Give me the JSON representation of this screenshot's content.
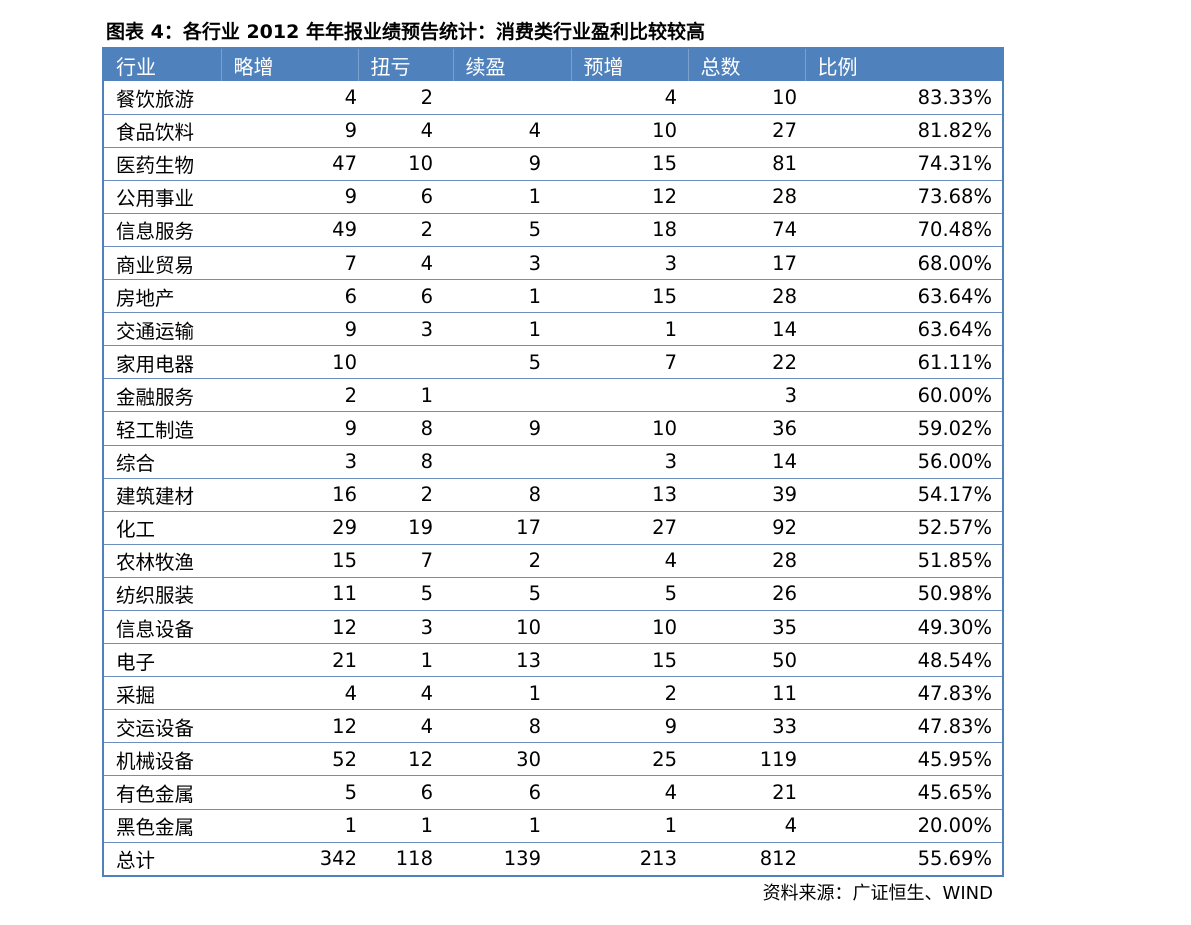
{
  "title": "图表 4：各行业 2012 年年报业绩预告统计：消费类行业盈利比较较高",
  "columns": [
    "行业",
    "略增",
    "扭亏",
    "续盈",
    "预增",
    "总数",
    "比例"
  ],
  "rows": [
    {
      "name": "餐饮旅游",
      "lue": "4",
      "niu": "2",
      "xu": "",
      "yu": "4",
      "total": "10",
      "ratio": "83.33%"
    },
    {
      "name": "食品饮料",
      "lue": "9",
      "niu": "4",
      "xu": "4",
      "yu": "10",
      "total": "27",
      "ratio": "81.82%"
    },
    {
      "name": "医药生物",
      "lue": "47",
      "niu": "10",
      "xu": "9",
      "yu": "15",
      "total": "81",
      "ratio": "74.31%"
    },
    {
      "name": "公用事业",
      "lue": "9",
      "niu": "6",
      "xu": "1",
      "yu": "12",
      "total": "28",
      "ratio": "73.68%"
    },
    {
      "name": "信息服务",
      "lue": "49",
      "niu": "2",
      "xu": "5",
      "yu": "18",
      "total": "74",
      "ratio": "70.48%"
    },
    {
      "name": "商业贸易",
      "lue": "7",
      "niu": "4",
      "xu": "3",
      "yu": "3",
      "total": "17",
      "ratio": "68.00%"
    },
    {
      "name": "房地产",
      "lue": "6",
      "niu": "6",
      "xu": "1",
      "yu": "15",
      "total": "28",
      "ratio": "63.64%"
    },
    {
      "name": "交通运输",
      "lue": "9",
      "niu": "3",
      "xu": "1",
      "yu": "1",
      "total": "14",
      "ratio": "63.64%"
    },
    {
      "name": "家用电器",
      "lue": "10",
      "niu": "",
      "xu": "5",
      "yu": "7",
      "total": "22",
      "ratio": "61.11%"
    },
    {
      "name": "金融服务",
      "lue": "2",
      "niu": "1",
      "xu": "",
      "yu": "",
      "total": "3",
      "ratio": "60.00%"
    },
    {
      "name": "轻工制造",
      "lue": "9",
      "niu": "8",
      "xu": "9",
      "yu": "10",
      "total": "36",
      "ratio": "59.02%"
    },
    {
      "name": "综合",
      "lue": "3",
      "niu": "8",
      "xu": "",
      "yu": "3",
      "total": "14",
      "ratio": "56.00%"
    },
    {
      "name": "建筑建材",
      "lue": "16",
      "niu": "2",
      "xu": "8",
      "yu": "13",
      "total": "39",
      "ratio": "54.17%"
    },
    {
      "name": "化工",
      "lue": "29",
      "niu": "19",
      "xu": "17",
      "yu": "27",
      "total": "92",
      "ratio": "52.57%"
    },
    {
      "name": "农林牧渔",
      "lue": "15",
      "niu": "7",
      "xu": "2",
      "yu": "4",
      "total": "28",
      "ratio": "51.85%"
    },
    {
      "name": "纺织服装",
      "lue": "11",
      "niu": "5",
      "xu": "5",
      "yu": "5",
      "total": "26",
      "ratio": "50.98%"
    },
    {
      "name": "信息设备",
      "lue": "12",
      "niu": "3",
      "xu": "10",
      "yu": "10",
      "total": "35",
      "ratio": "49.30%"
    },
    {
      "name": "电子",
      "lue": "21",
      "niu": "1",
      "xu": "13",
      "yu": "15",
      "total": "50",
      "ratio": "48.54%"
    },
    {
      "name": "采掘",
      "lue": "4",
      "niu": "4",
      "xu": "1",
      "yu": "2",
      "total": "11",
      "ratio": "47.83%"
    },
    {
      "name": "交运设备",
      "lue": "12",
      "niu": "4",
      "xu": "8",
      "yu": "9",
      "total": "33",
      "ratio": "47.83%"
    },
    {
      "name": "机械设备",
      "lue": "52",
      "niu": "12",
      "xu": "30",
      "yu": "25",
      "total": "119",
      "ratio": "45.95%"
    },
    {
      "name": "有色金属",
      "lue": "5",
      "niu": "6",
      "xu": "6",
      "yu": "4",
      "total": "21",
      "ratio": "45.65%"
    },
    {
      "name": "黑色金属",
      "lue": "1",
      "niu": "1",
      "xu": "1",
      "yu": "1",
      "total": "4",
      "ratio": "20.00%"
    },
    {
      "name": "总计",
      "lue": "342",
      "niu": "118",
      "xu": "139",
      "yu": "213",
      "total": "812",
      "ratio": "55.69%"
    }
  ],
  "source": "资料来源：广证恒生、WIND",
  "colors": {
    "header_bg": "#4f81bd",
    "header_text": "#ffffff",
    "border": "#4f81bd"
  }
}
